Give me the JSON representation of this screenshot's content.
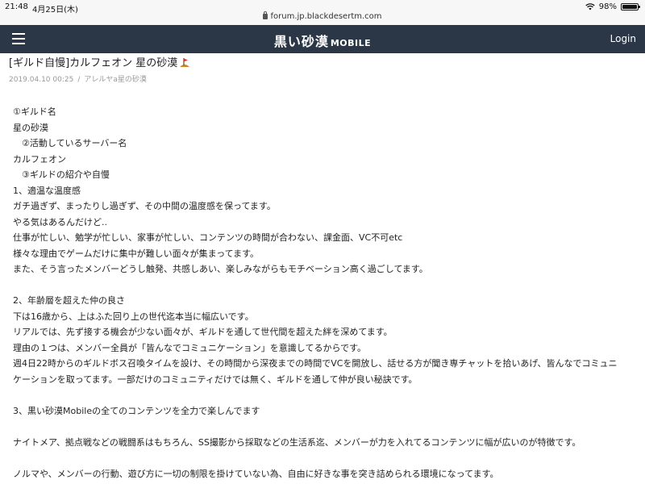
{
  "status_bar": {
    "time": "21:48",
    "date": "4月25日(木)",
    "url": "forum.jp.blackdesertm.com",
    "battery": "98%",
    "battery_level": 0.98
  },
  "header": {
    "logo_jp": "黒い砂漠",
    "logo_en": "MOBILE",
    "login_label": "Login",
    "bg_color": "#2b3747"
  },
  "post": {
    "title": "[ギルド自慢]カルフェオン 星の砂漠",
    "date": "2019.04.10 00:25",
    "separator": "/",
    "author": "アレルヤa星の砂漠",
    "body_lines": [
      "①ギルド名",
      "星の砂漠",
      "　②活動しているサーバー名",
      "カルフェオン",
      "　③ギルドの紹介や自慢",
      "1、適温な温度感",
      "ガチ過ぎず、まったりし過ぎず、その中間の温度感を保ってます。",
      "やる気はあるんだけど..",
      "仕事が忙しい、勉学が忙しい、家事が忙しい、コンテンツの時間が合わない、課金面、VC不可etc",
      "様々な理由でゲームだけに集中が難しい面々が集まってます。",
      "また、そう言ったメンバーどうし触発、共感しあい、楽しみながらもモチベーション高く過ごしてます。",
      "",
      "2、年齢層を超えた仲の良さ",
      "下は16歳から、上はふた回り上の世代迄本当に幅広いです。",
      "リアルでは、先ず接する機会が少ない面々が、ギルドを通して世代間を超えた絆を深めてます。",
      "理由の１つは、メンバー全員が「皆んなでコミュニケーション」を意識してるからです。",
      "週4日22時からのギルドボス召喚タイムを設け、その時間から深夜までの時間でVCを開放し、話せる方が聞き専チャットを拾いあげ、皆んなでコミュニ",
      "ケーションを取ってます。一部だけのコミュニティだけでは無く、ギルドを通して仲が良い秘訣です。",
      "",
      "3、黒い砂漠Mobileの全てのコンテンツを全力で楽しんでます",
      "",
      "ナイトメア、拠点戦などの戦闘系はもちろん、SS撮影から採取などの生活系迄、メンバーが力を入れてるコンテンツに幅が広いのが特徴です。",
      "",
      "ノルマや、メンバーの行動、遊び方に一切の制限を掛けていない為、自由に好きな事を突き詰められる環境になってます。"
    ]
  }
}
